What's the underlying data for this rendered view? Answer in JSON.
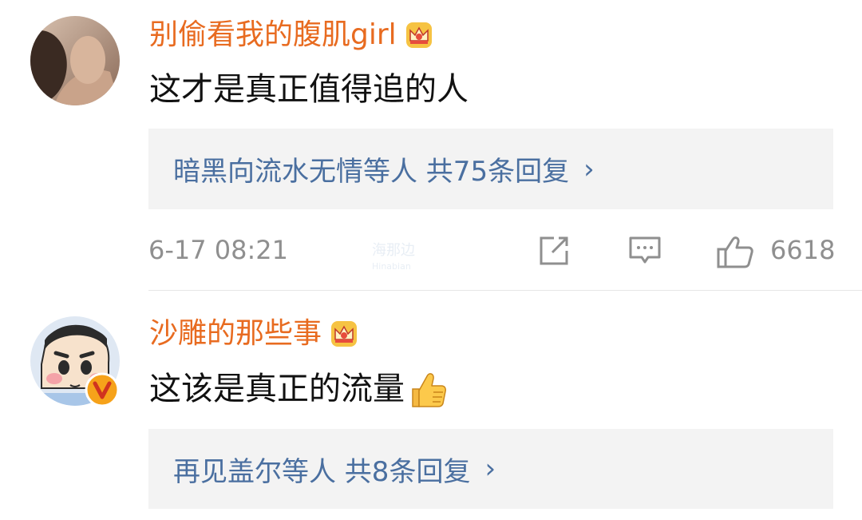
{
  "comments": [
    {
      "username": "别偷看我的腹肌girl",
      "text": "这才是真正值得追的人",
      "reply_summary": "暗黑向流水无情等人 共75条回复",
      "reply_chevron": "›",
      "timestamp": "6-17 08:21",
      "likes": "6618",
      "badge_icon": "crown-icon"
    },
    {
      "username": "沙雕的那些事",
      "text": "这该是真正的流量",
      "reply_summary": "再见盖尔等人 共8条回复",
      "reply_chevron": "›",
      "badge_icon": "crown-icon",
      "verified_badge": "v-icon"
    }
  ],
  "watermark": {
    "line1": "海那边",
    "line2": "Hinabian"
  },
  "colors": {
    "username": "#e86b20",
    "link": "#4a6fa0",
    "meta": "#8f8f8f",
    "reply_bg": "#f3f3f3"
  }
}
